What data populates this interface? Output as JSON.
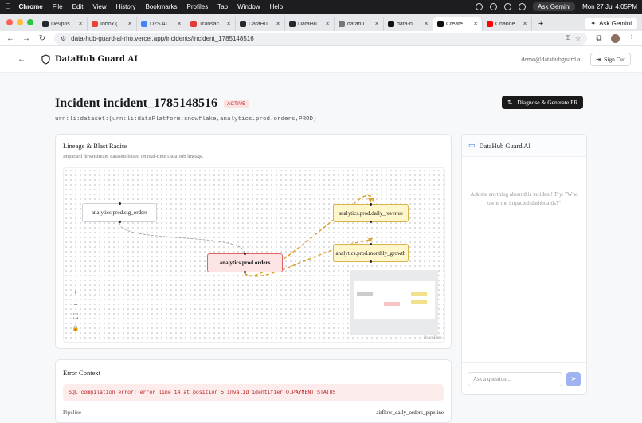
{
  "menubar": {
    "app": "Chrome",
    "items": [
      "File",
      "Edit",
      "View",
      "History",
      "Bookmarks",
      "Profiles",
      "Tab",
      "Window",
      "Help"
    ],
    "ask_gemini": "Ask Gemini",
    "clock": "Mon 27 Jul  4:05PM"
  },
  "tabs": [
    {
      "label": "Devpos",
      "color": "#24292f"
    },
    {
      "label": "Inbox (",
      "color": "#ea4335"
    },
    {
      "label": "D2S AI",
      "color": "#4285f4"
    },
    {
      "label": "Transac",
      "color": "#e53935"
    },
    {
      "label": "DataHu",
      "color": "#24292f"
    },
    {
      "label": "DataHu",
      "color": "#24292f"
    },
    {
      "label": "datahu",
      "color": "#777"
    },
    {
      "label": "data-h",
      "color": "#111"
    },
    {
      "label": "Create",
      "color": "#111",
      "active": true
    },
    {
      "label": "Channe",
      "color": "#ff0000"
    }
  ],
  "tabbar": {
    "ask_gemini": "Ask Gemini"
  },
  "address": {
    "url": "data-hub-guard-ai-rho.vercel.app/incidents/incident_1785148516"
  },
  "header": {
    "brand": "DataHub Guard AI",
    "user": "demo@datahubguard.ai",
    "signout": "Sign Out"
  },
  "incident": {
    "title": "Incident incident_1785148516",
    "status": "ACTIVE",
    "urn": "urn:li:dataset:(urn:li:dataPlatform:snowflake,analytics.prod.orders,PROD)",
    "action": "Diagnose & Generate PR"
  },
  "lineage": {
    "title": "Lineage & Blast Radius",
    "subtitle": "Impacted downstream datasets based on real-time DataHub lineage.",
    "nodes": {
      "upstream": "analytics.prod.stg_orders",
      "source": "analytics.prod.orders",
      "down1": "analytics.prod.daily_revenue",
      "down2": "analytics.prod.monthly_growth"
    },
    "controls": {
      "zoom_in": "+",
      "zoom_out": "−",
      "fit": "⛶",
      "lock": "🔒"
    },
    "attribution": "React Flow"
  },
  "chat": {
    "title": "DataHub Guard AI",
    "empty": "Ask me anything about this incident! Try: \"Who owns the impacted dashboards?\"",
    "placeholder": "Ask a question..."
  },
  "error": {
    "title": "Error Context",
    "message": "SQL compilation error: error line 14 at position 5 invalid identifier O.PAYMENT_STATUS",
    "pipeline_label": "Pipeline",
    "pipeline_value": "airflow_daily_orders_pipeline"
  },
  "colors": {
    "accent": "#1a1a1a",
    "danger": "#c62828",
    "warn_edge": "#e0a030",
    "send": "#9fb3f0"
  }
}
